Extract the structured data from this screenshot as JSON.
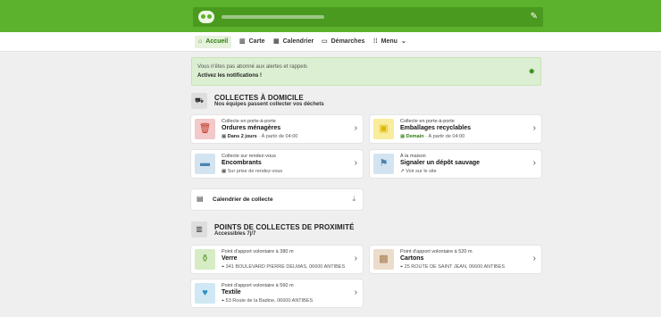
{
  "header": {
    "logo_icon": "recycle-logo-icon",
    "edit_icon": "pencil-icon",
    "brand_color": "#5cb22c"
  },
  "nav": {
    "items": [
      {
        "label": "Accueil",
        "icon": "home-icon"
      },
      {
        "label": "Carte",
        "icon": "map-icon"
      },
      {
        "label": "Calendrier",
        "icon": "calendar-icon"
      },
      {
        "label": "Démarches",
        "icon": "id-card-icon"
      },
      {
        "label": "Menu",
        "icon": "grid-icon"
      }
    ]
  },
  "banner": {
    "line1": "Vous n'êtes pas abonné aux alertes et rappels",
    "line2": "Activez les notifications !"
  },
  "home": {
    "title": "COLLECTES À DOMICILE",
    "subtitle": "Nos équipes passent collecter vos déchets",
    "cards": [
      {
        "kicker": "Collecte en porte-à-porte",
        "title": "Ordures ménagères",
        "meta_strong": "Dans 2 jours",
        "meta_sep": "·",
        "meta_rest": "À partir de 04:00",
        "tile_color": "#f4c9c9",
        "icon_color": "#c0392b"
      },
      {
        "kicker": "Collecte en porte-à-porte",
        "title": "Emballages recyclables",
        "meta_strong": "Demain",
        "meta_sep": "·",
        "meta_rest": "À partir de 04:00",
        "tile_color": "#f9ec9c",
        "icon_color": "#e0b400"
      },
      {
        "kicker": "Collecte sur rendez-vous",
        "title": "Encombrants",
        "meta_strong": "",
        "meta_sep": "",
        "meta_rest": "Sur prise de rendez-vous",
        "tile_color": "#d3e4f0",
        "icon_color": "#4a84b0"
      },
      {
        "kicker": "À la maison",
        "title": "Signaler un dépôt sauvage",
        "meta_strong": "",
        "meta_sep": "",
        "meta_rest": "Voir sur le site",
        "tile_color": "#d3e4f0",
        "icon_color": "#4a84b0"
      }
    ],
    "calendar_label": "Calendrier de collecte"
  },
  "proximity": {
    "title": "POINTS DE COLLECTES DE PROXIMITÉ",
    "subtitle": "Accessibles 7j/7",
    "cards": [
      {
        "kicker": "Point d'apport volontaire à 380 m",
        "title": "Verre",
        "address": "341 BOULEVARD PIERRE DELMAS, 06600 ANTIBES",
        "tile_color": "#d6ecc4",
        "icon_color": "#5a9b2f"
      },
      {
        "kicker": "Point d'apport volontaire à 520 m",
        "title": "Cartons",
        "address": "25 ROUTE DE SAINT JEAN, 06600 ANTIBES",
        "tile_color": "#ecdccb",
        "icon_color": "#a77b4f"
      },
      {
        "kicker": "Point d'apport volontaire à 560 m",
        "title": "Textile",
        "address": "53 Route de la Badine, 06600 ANTIBES",
        "tile_color": "#cfe8f4",
        "icon_color": "#2f8fbf"
      }
    ]
  }
}
